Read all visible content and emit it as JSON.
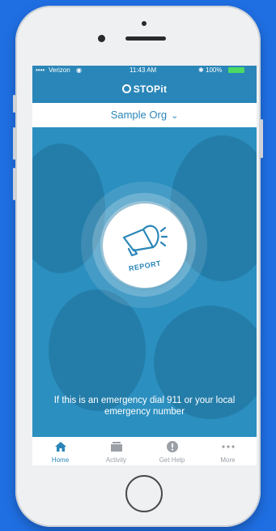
{
  "status_bar": {
    "carrier": "Verizon",
    "time": "11:43 AM",
    "battery": "100%"
  },
  "app": {
    "brand": "STOPit"
  },
  "org_selector": {
    "label": "Sample Org"
  },
  "report": {
    "label": "REPORT"
  },
  "emergency_text": "If this is an emergency dial 911 or your local emergency number",
  "tabs": [
    {
      "label": "Home",
      "icon": "home-icon",
      "active": true
    },
    {
      "label": "Activity",
      "icon": "inbox-icon",
      "active": false
    },
    {
      "label": "Get Help",
      "icon": "alert-icon",
      "active": false
    },
    {
      "label": "More",
      "icon": "more-icon",
      "active": false
    }
  ],
  "colors": {
    "background": "#1f6fe3",
    "brand_blue": "#2a86b8",
    "inactive_tab": "#9aa0a6"
  }
}
